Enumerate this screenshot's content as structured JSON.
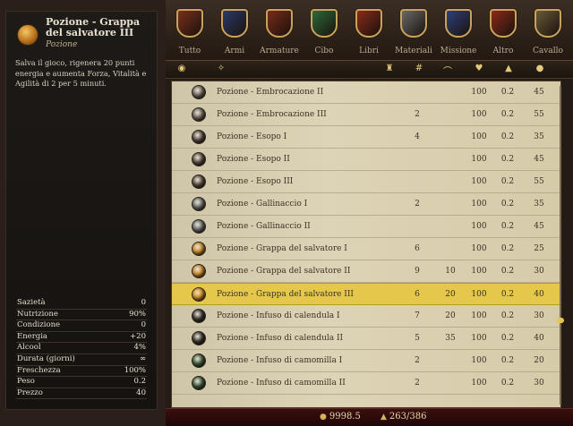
{
  "detail": {
    "title": "Pozione - Grappa del salvatore III",
    "type": "Pozione",
    "description": "Salva il gioco, rigenera 20 punti energia e aumenta Forza, Vitalità e Agilità di 2 per 5 minuti.",
    "stats": [
      {
        "label": "Sazietà",
        "value": "0"
      },
      {
        "label": "Nutrizione",
        "value": "90%"
      },
      {
        "label": "Condizione",
        "value": "0"
      },
      {
        "label": "Energia",
        "value": "+20"
      },
      {
        "label": "Alcool",
        "value": "4%"
      },
      {
        "label": "Durata (giorni)",
        "value": "∞"
      },
      {
        "label": "Freschezza",
        "value": "100%"
      },
      {
        "label": "Peso",
        "value": "0.2"
      },
      {
        "label": "Prezzo",
        "value": "40"
      }
    ]
  },
  "tabs": [
    {
      "label": "Tutto",
      "color": "#7a2f1c"
    },
    {
      "label": "Armi",
      "color": "#2c3a6a"
    },
    {
      "label": "Armature",
      "color": "#7a2a1a"
    },
    {
      "label": "Cibo",
      "color": "#2d6a3a"
    },
    {
      "label": "Libri",
      "color": "#8a2a1a"
    },
    {
      "label": "Materiali",
      "color": "#6a6a6a"
    },
    {
      "label": "Missione",
      "color": "#2f3f7a"
    },
    {
      "label": "Altro",
      "color": "#8a2a1a"
    },
    {
      "label": "Cavallo",
      "color": "#6a5a3a"
    }
  ],
  "column_icons": [
    "potion-sort-icon",
    "type-sort-icon",
    "armor-icon",
    "count-icon",
    "durability-icon",
    "condition-icon",
    "weight-icon",
    "price-icon"
  ],
  "items": [
    {
      "name": "Pozione - Embrocazione II",
      "qty": "",
      "extra": "",
      "cond": "100",
      "weight": "0.2",
      "price": "45",
      "color": "#6f6558"
    },
    {
      "name": "Pozione - Embrocazione III",
      "qty": "2",
      "extra": "",
      "cond": "100",
      "weight": "0.2",
      "price": "55",
      "color": "#6f6558"
    },
    {
      "name": "Pozione - Esopo I",
      "qty": "4",
      "extra": "",
      "cond": "100",
      "weight": "0.2",
      "price": "35",
      "color": "#5a4e42"
    },
    {
      "name": "Pozione - Esopo II",
      "qty": "",
      "extra": "",
      "cond": "100",
      "weight": "0.2",
      "price": "45",
      "color": "#5a4e42"
    },
    {
      "name": "Pozione - Esopo III",
      "qty": "",
      "extra": "",
      "cond": "100",
      "weight": "0.2",
      "price": "55",
      "color": "#5a4e42"
    },
    {
      "name": "Pozione - Gallinaccio I",
      "qty": "2",
      "extra": "",
      "cond": "100",
      "weight": "0.2",
      "price": "35",
      "color": "#6a6a66"
    },
    {
      "name": "Pozione - Gallinaccio II",
      "qty": "",
      "extra": "",
      "cond": "100",
      "weight": "0.2",
      "price": "45",
      "color": "#6a6a66"
    },
    {
      "name": "Pozione - Grappa del salvatore I",
      "qty": "6",
      "extra": "",
      "cond": "100",
      "weight": "0.2",
      "price": "25",
      "color": "#c98a2c"
    },
    {
      "name": "Pozione - Grappa del salvatore II",
      "qty": "9",
      "extra": "10",
      "cond": "100",
      "weight": "0.2",
      "price": "30",
      "color": "#c98a2c"
    },
    {
      "name": "Pozione - Grappa del salvatore III",
      "qty": "6",
      "extra": "20",
      "cond": "100",
      "weight": "0.2",
      "price": "40",
      "color": "#c98a2c",
      "selected": true
    },
    {
      "name": "Pozione - Infuso di calendula I",
      "qty": "7",
      "extra": "20",
      "cond": "100",
      "weight": "0.2",
      "price": "30",
      "color": "#3a3530"
    },
    {
      "name": "Pozione - Infuso di calendula II",
      "qty": "5",
      "extra": "35",
      "cond": "100",
      "weight": "0.2",
      "price": "40",
      "color": "#3a3530"
    },
    {
      "name": "Pozione - Infuso di camomilla I",
      "qty": "2",
      "extra": "",
      "cond": "100",
      "weight": "0.2",
      "price": "20",
      "color": "#3f5a3a"
    },
    {
      "name": "Pozione - Infuso di camomilla II",
      "qty": "2",
      "extra": "",
      "cond": "100",
      "weight": "0.2",
      "price": "30",
      "color": "#3f5a3a"
    }
  ],
  "footer": {
    "money": "9998.5",
    "weight": "263/386"
  }
}
